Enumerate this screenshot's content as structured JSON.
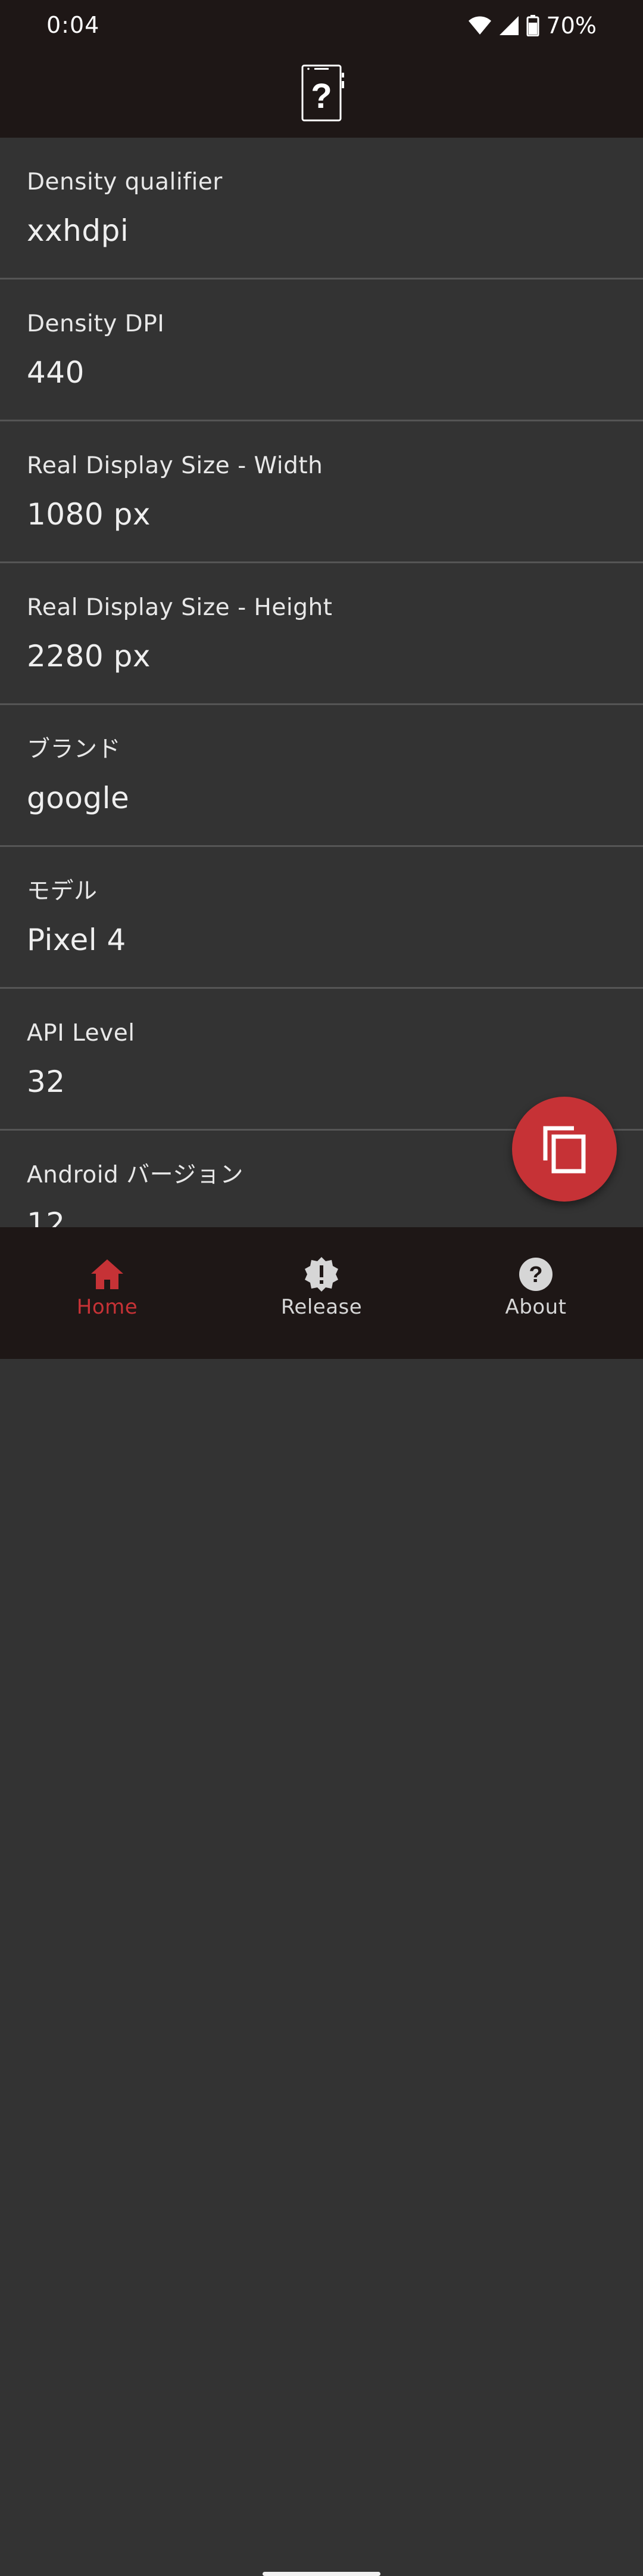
{
  "status_bar": {
    "time": "0:04",
    "battery": "70%"
  },
  "items": [
    {
      "label": "Density qualifier",
      "value": "xxhdpi"
    },
    {
      "label": "Density DPI",
      "value": "440"
    },
    {
      "label": "Real Display Size - Width",
      "value": "1080 px"
    },
    {
      "label": "Real Display Size - Height",
      "value": "2280 px"
    },
    {
      "label": "ブランド",
      "value": "google"
    },
    {
      "label": "モデル",
      "value": "Pixel 4"
    },
    {
      "label": "API Level",
      "value": "32"
    },
    {
      "label": "Android バージョン",
      "value": "12"
    }
  ],
  "nav": {
    "home": "Home",
    "release": "Release",
    "about": "About"
  },
  "colors": {
    "accent": "#C63236",
    "bar_background": "#1E1716",
    "list_background": "#333333",
    "divider": "#555555"
  },
  "icons": {
    "logo": "phone-question-icon",
    "fab": "copy-icon",
    "home": "home-icon",
    "release": "alert-badge-icon",
    "about": "help-circle-icon"
  }
}
